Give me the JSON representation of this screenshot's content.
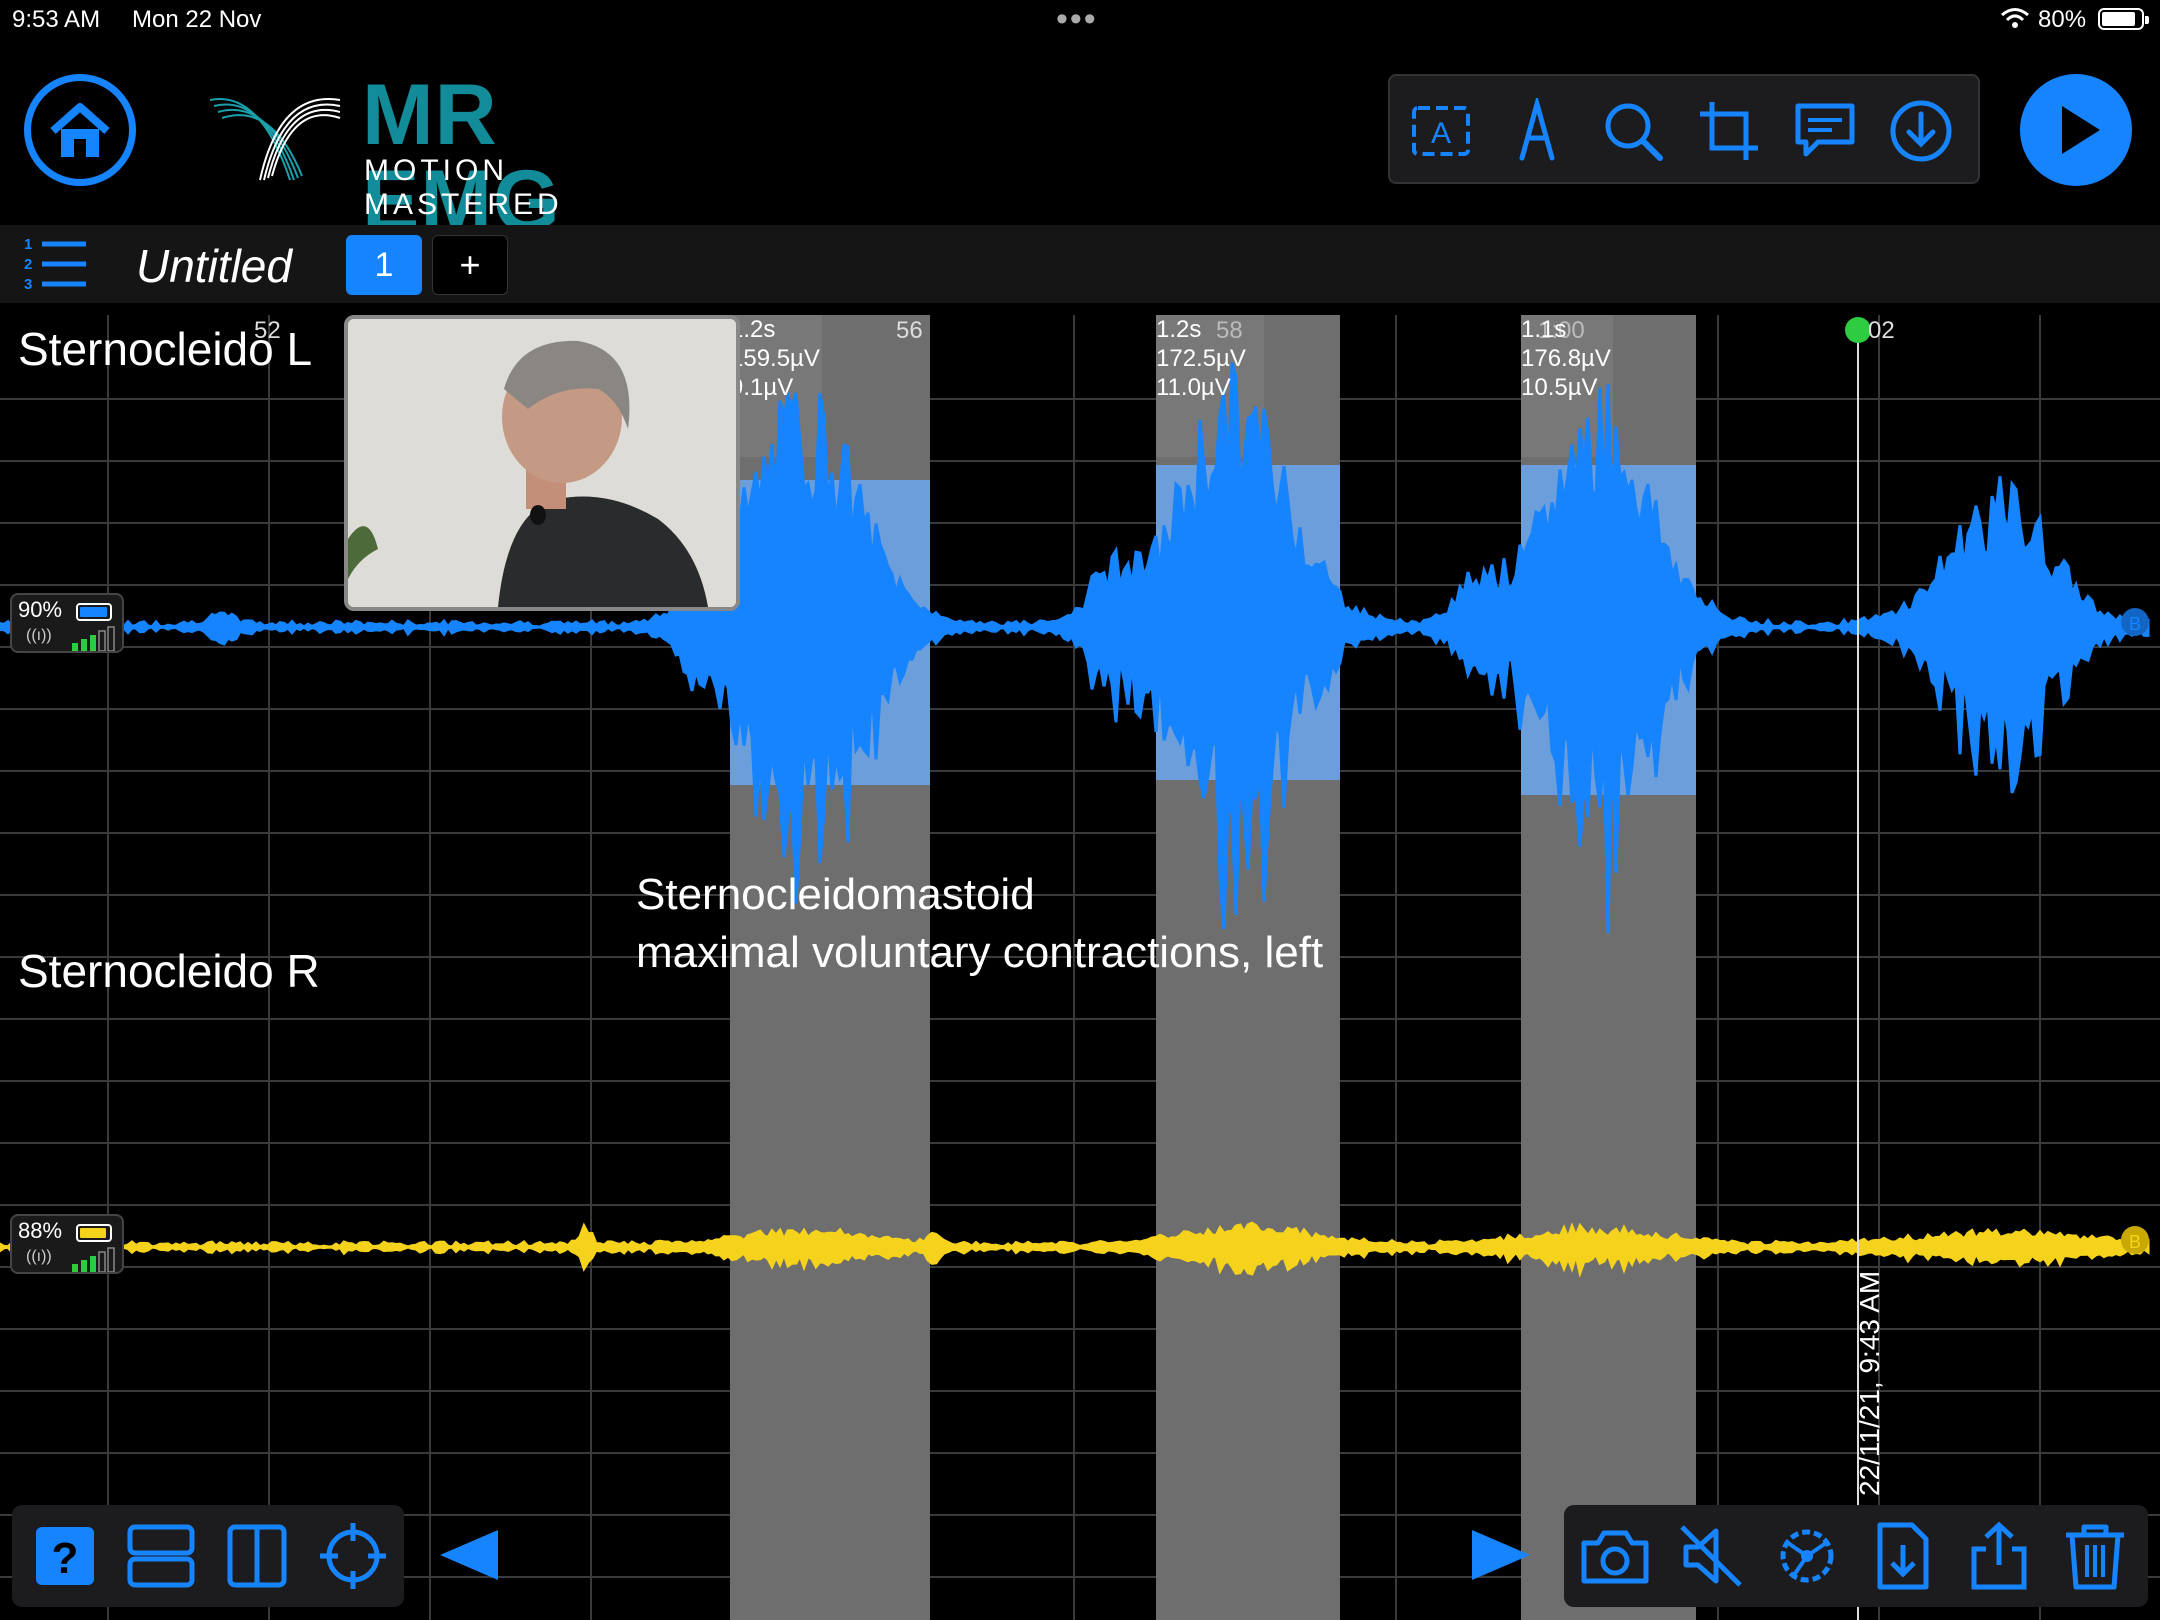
{
  "status_bar": {
    "time": "9:53 AM",
    "date": "Mon 22 Nov",
    "battery": "80%"
  },
  "header": {
    "brand": "MR EMG",
    "tagline": "MOTION MASTERED",
    "toolbar": [
      "text-annotation-icon",
      "marker-icon",
      "search-icon",
      "crop-icon",
      "comment-icon",
      "download-icon"
    ],
    "accent": "#1684ff"
  },
  "tabs": {
    "doc_title": "Untitled",
    "active_tab": "1",
    "add_tab": "+"
  },
  "channels": [
    {
      "name": "Sternocleido L",
      "color": "#1684ff",
      "sensor_battery": "90%"
    },
    {
      "name": "Sternocleido R",
      "color": "#f5d21c",
      "sensor_battery": "88%"
    }
  ],
  "time_ticks": [
    "52",
    "56",
    "58",
    "1:00",
    "02"
  ],
  "measurements": [
    {
      "duration": "1.2s",
      "peak": "159.5µV",
      "baseline": "9.1µV"
    },
    {
      "duration": "1.2s",
      "peak": "172.5µV",
      "baseline": "11.0µV"
    },
    {
      "duration": "1.1s",
      "peak": "176.8µV",
      "baseline": "10.5µV"
    }
  ],
  "annotation": {
    "line1": "Sternocleidomastoid",
    "line2": "maximal voluntary contractions, left"
  },
  "cursor_timestamp": "22/11/21, 9:43 AM",
  "bottom_left": [
    "help-icon",
    "split-horizontal-icon",
    "split-vertical-icon",
    "crosshair-icon"
  ],
  "bottom_right": [
    "camera-icon",
    "mute-icon",
    "settings-icon",
    "export-file-icon",
    "share-icon",
    "trash-icon"
  ]
}
